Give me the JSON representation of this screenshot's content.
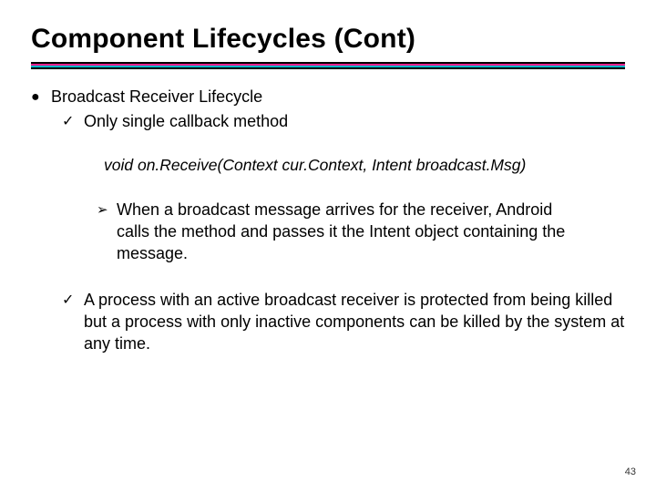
{
  "title": "Component Lifecycles (Cont)",
  "bullets": {
    "item1": {
      "text": "Broadcast Receiver Lifecycle"
    },
    "item1_1": {
      "text": "Only single callback method"
    },
    "code_line": "void on.Receive(Context cur.Context, Intent broadcast.Msg)",
    "item1_1a": {
      "text": "When a broadcast message arrives for the receiver, Android calls the method and passes it the Intent object containing the message."
    },
    "item1_2": {
      "text": "A process with an active broadcast receiver is protected from being killed but a process with only inactive components can be killed by the system at any time."
    }
  },
  "markers": {
    "dot": "●",
    "check": "✓",
    "arrow": "➢"
  },
  "page_number": "43"
}
